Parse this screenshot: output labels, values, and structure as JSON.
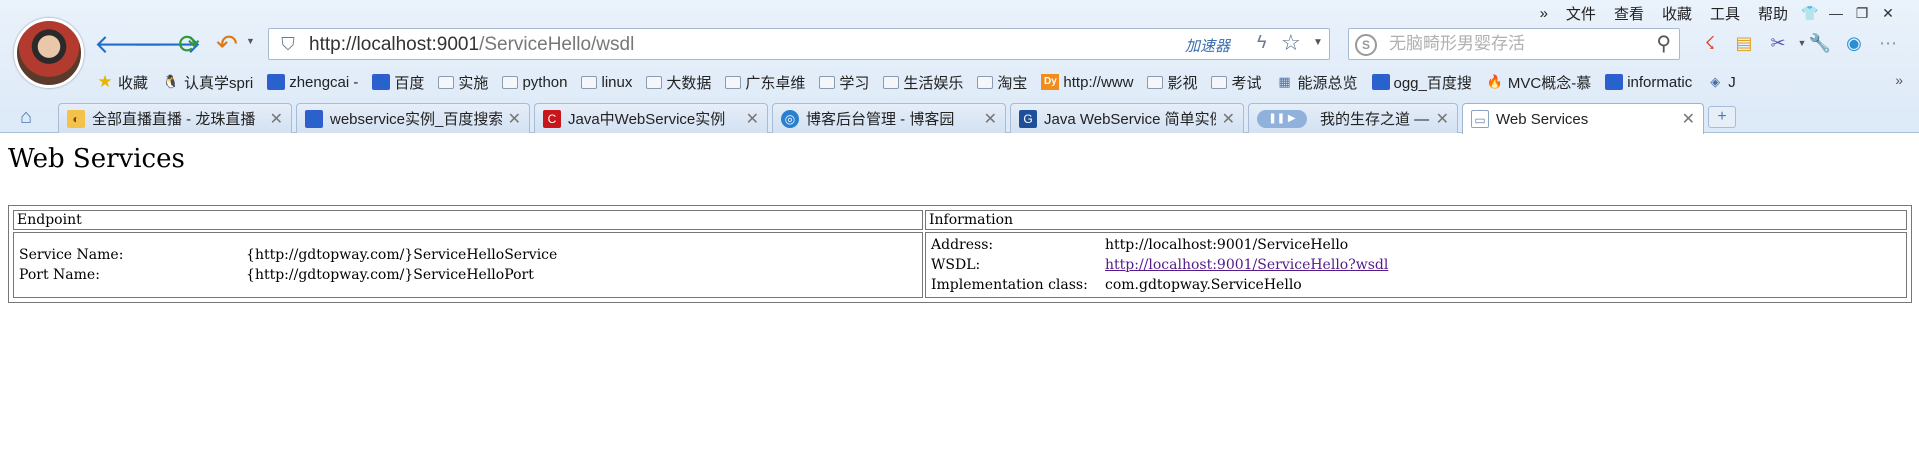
{
  "menu": {
    "more": "»",
    "items": [
      "文件",
      "查看",
      "收藏",
      "工具",
      "帮助"
    ]
  },
  "address": {
    "url_host": "http://localhost:9001",
    "url_path": "/ServiceHello/wsdl",
    "accelerator": "加速器"
  },
  "search": {
    "placeholder": "无脑畸形男婴存活"
  },
  "bookmarks": [
    {
      "label": "收藏",
      "icon": "star-icon"
    },
    {
      "label": "认真学spri",
      "icon": "penguin-icon"
    },
    {
      "label": "zhengcai -",
      "icon": "paw-icon"
    },
    {
      "label": "百度",
      "icon": "paw-icon"
    },
    {
      "label": "实施",
      "icon": "folder-icon"
    },
    {
      "label": "python",
      "icon": "folder-icon"
    },
    {
      "label": "linux",
      "icon": "folder-icon"
    },
    {
      "label": "大数据",
      "icon": "folder-icon"
    },
    {
      "label": "广东卓维",
      "icon": "folder-icon"
    },
    {
      "label": "学习",
      "icon": "folder-icon"
    },
    {
      "label": "生活娱乐",
      "icon": "folder-icon"
    },
    {
      "label": "淘宝",
      "icon": "folder-icon"
    },
    {
      "label": "http://www",
      "icon": "dy-icon"
    },
    {
      "label": "影视",
      "icon": "folder-icon"
    },
    {
      "label": "考试",
      "icon": "folder-icon"
    },
    {
      "label": "能源总览",
      "icon": "doc-icon"
    },
    {
      "label": "ogg_百度搜",
      "icon": "paw-icon"
    },
    {
      "label": "MVC概念-慕",
      "icon": "fire-icon"
    },
    {
      "label": "informatic",
      "icon": "paw-icon"
    },
    {
      "label": "J",
      "icon": "cube-icon"
    }
  ],
  "bookmarks_more": "»",
  "tabs": [
    {
      "label": "全部直播直播 - 龙珠直播",
      "active": false
    },
    {
      "label": "webservice实例_百度搜索",
      "active": false
    },
    {
      "label": "Java中WebService实例",
      "active": false
    },
    {
      "label": "博客后台管理 - 博客园",
      "active": false
    },
    {
      "label": "Java WebService 简单实例",
      "active": false
    },
    {
      "label": "我的生存之道 —",
      "active": false
    },
    {
      "label": "Web Services",
      "active": true
    }
  ],
  "new_tab": "+",
  "page": {
    "title": "Web Services",
    "table": {
      "headers": [
        "Endpoint",
        "Information"
      ],
      "endpoint": {
        "service_name_label": "Service Name:",
        "service_name": "{http://gdtopway.com/}ServiceHelloService",
        "port_name_label": "Port Name:",
        "port_name": "{http://gdtopway.com/}ServiceHelloPort"
      },
      "information": {
        "address_label": "Address:",
        "address": "http://localhost:9001/ServiceHello",
        "wsdl_label": "WSDL:",
        "wsdl": "http://localhost:9001/ServiceHello?wsdl",
        "impl_label": "Implementation class:",
        "impl": "com.gdtopway.ServiceHello"
      }
    }
  }
}
